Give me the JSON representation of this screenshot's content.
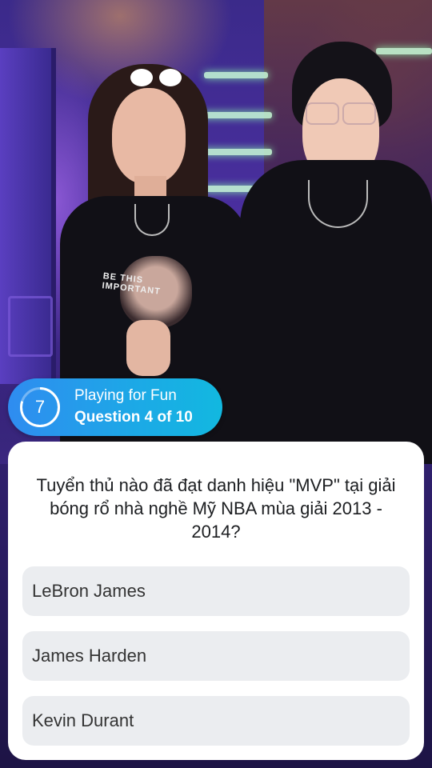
{
  "status": {
    "timer": "7",
    "mode_label": "Playing for Fun",
    "progress_label": "Question 4 of 10"
  },
  "quiz": {
    "question": "Tuyển thủ nào đã đạt danh hiệu \"MVP\" tại giải bóng rổ nhà nghề Mỹ NBA mùa giải 2013 - 2014?",
    "answers": [
      {
        "label": "LeBron James"
      },
      {
        "label": "James Harden"
      },
      {
        "label": "Kevin Durant"
      }
    ]
  },
  "video": {
    "shirt_print": "BE THIS IMPORTANT"
  },
  "colors": {
    "pill_gradient_start": "#2f8cf0",
    "pill_gradient_end": "#12b8e0",
    "card_bg": "#ffffff",
    "answer_bg": "#ebedf0"
  }
}
